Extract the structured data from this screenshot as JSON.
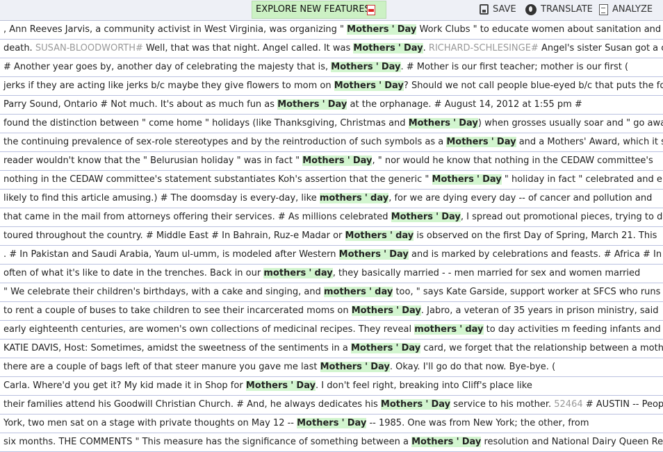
{
  "toolbar": {
    "explore_label": "EXPLORE NEW FEATURES",
    "save_label": "SAVE",
    "translate_label": "TRANSLATE",
    "analyze_label": "ANALYZE"
  },
  "rows": [
    {
      "segments": [
        {
          "t": "text",
          "v": ", Ann Reeves Jarvis, a community activist in West Virginia, was organizing \" "
        },
        {
          "t": "kw",
          "a": "Mothers",
          "b": "'",
          "c": "Day"
        },
        {
          "t": "text",
          "v": " Work Clubs \" to educate women about sanitation and public health"
        }
      ]
    },
    {
      "segments": [
        {
          "t": "text",
          "v": "death. "
        },
        {
          "t": "meta",
          "v": "SUSAN-BLOODWORTH#"
        },
        {
          "t": "text",
          "v": " Well, that was that night. Angel called. It was "
        },
        {
          "t": "kw",
          "a": "Mothers",
          "b": "'",
          "c": "Day"
        },
        {
          "t": "text",
          "v": ". "
        },
        {
          "t": "meta",
          "v": "RICHARD-SCHLESINGE#"
        },
        {
          "t": "text",
          "v": " Angel's sister Susan got a call that even"
        }
      ]
    },
    {
      "segments": [
        {
          "t": "text",
          "v": "# Another year goes by, another day of celebrating the majesty that is, "
        },
        {
          "t": "kw",
          "a": "Mothers",
          "b": "'",
          "c": "Day"
        },
        {
          "t": "text",
          "v": ". # Mother is our first teacher; mother is our first ("
        }
      ]
    },
    {
      "segments": [
        {
          "t": "text",
          "v": "jerks if they are acting like jerks b/c maybe they give flowers to mom on "
        },
        {
          "t": "kw",
          "a": "Mothers",
          "b": "'",
          "c": "Day"
        },
        {
          "t": "text",
          "v": "? Should we not call people blue-eyed b/c that puts the focus on"
        }
      ]
    },
    {
      "segments": [
        {
          "t": "text",
          "v": "Parry Sound, Ontario # Not much. It's about as much fun as "
        },
        {
          "t": "kw",
          "a": "Mothers",
          "b": "'",
          "c": "Day"
        },
        {
          "t": "text",
          "v": " at the orphanage. # August 14, 2012 at 1:55 pm #"
        }
      ]
    },
    {
      "segments": [
        {
          "t": "text",
          "v": "found the distinction between \" come home \" holidays (like Thanksgiving, Christmas and "
        },
        {
          "t": "kw",
          "a": "Mothers",
          "b": "'",
          "c": "Day"
        },
        {
          "t": "text",
          "v": ") when grosses usually soar and \" go away \" holidays"
        }
      ]
    },
    {
      "segments": [
        {
          "t": "text",
          "v": "the continuing prevalence of sex-role stereotypes and by the reintroduction of such symbols as a "
        },
        {
          "t": "kw",
          "a": "Mothers",
          "b": "'",
          "c": "Day"
        },
        {
          "t": "text",
          "v": " and a Mothers' Award, which it sees as enc"
        }
      ]
    },
    {
      "segments": [
        {
          "t": "text",
          "v": "reader wouldn't know that the \" Belurusian holiday \" was in fact \" "
        },
        {
          "t": "kw",
          "a": "Mothers",
          "b": "'",
          "c": "Day"
        },
        {
          "t": "text",
          "v": ", \" nor would he know that nothing in the CEDAW committee's"
        }
      ]
    },
    {
      "segments": [
        {
          "t": "text",
          "v": "nothing in the CEDAW committee's statement substantiates Koh's assertion that the generic \" "
        },
        {
          "t": "kw",
          "a": "Mothers",
          "b": "'",
          "c": "Day"
        },
        {
          "t": "text",
          "v": " \" holiday in fact \" celebrated and encouraged"
        }
      ]
    },
    {
      "segments": [
        {
          "t": "text",
          "v": "likely to find this article amusing.) # The doomsday is every-day, like "
        },
        {
          "t": "kw",
          "a": "mothers",
          "b": "'",
          "c": "day"
        },
        {
          "t": "text",
          "v": ", for we are dying every day -- of cancer and pollution and"
        }
      ]
    },
    {
      "segments": [
        {
          "t": "text",
          "v": "that came in the mail from attorneys offering their services. # As millions celebrated "
        },
        {
          "t": "kw",
          "a": "Mothers",
          "b": "'",
          "c": "Day"
        },
        {
          "t": "text",
          "v": ", I spread out promotional pieces, trying to distinguish in"
        }
      ]
    },
    {
      "segments": [
        {
          "t": "text",
          "v": "toured throughout the country. # Middle East # In Bahrain, Ruz-e Madar or "
        },
        {
          "t": "kw",
          "a": "Mothers",
          "b": "'",
          "c": "day"
        },
        {
          "t": "text",
          "v": " is observed on the first Day of Spring, March 21. This"
        }
      ]
    },
    {
      "segments": [
        {
          "t": "text",
          "v": ". # In Pakistan and Saudi Arabia, Yaum ul-umm, is modeled after Western "
        },
        {
          "t": "kw",
          "a": "Mothers",
          "b": "'",
          "c": "Day"
        },
        {
          "t": "text",
          "v": " and is marked by celebrations and feasts. # Africa # In Ethiopia"
        }
      ]
    },
    {
      "segments": [
        {
          "t": "text",
          "v": "often of what it's like to date in the trenches. Back in our "
        },
        {
          "t": "kw",
          "a": "mothers",
          "b": "'",
          "c": "day"
        },
        {
          "t": "text",
          "v": ", they basically married - - men married for sex and women married"
        }
      ]
    },
    {
      "segments": [
        {
          "t": "text",
          "v": "\" We celebrate their children's birthdays, with a cake and singing, and "
        },
        {
          "t": "kw",
          "a": "mothers",
          "b": "'",
          "c": "day"
        },
        {
          "t": "text",
          "v": " too, \" says Kate Garside, support worker at SFCS who runs"
        }
      ]
    },
    {
      "segments": [
        {
          "t": "text",
          "v": "to rent a couple of buses to take children to see their incarcerated moms on "
        },
        {
          "t": "kw",
          "a": "Mothers",
          "b": "'",
          "c": "Day"
        },
        {
          "t": "text",
          "v": ". Jabro, a veteran of 35 years in prison ministry, said"
        }
      ]
    },
    {
      "segments": [
        {
          "t": "text",
          "v": "early eighteenth centuries, are women's own collections of medicinal recipes. They reveal "
        },
        {
          "t": "kw",
          "a": "mothers",
          "b": "'",
          "c": "day"
        },
        {
          "t": "text",
          "v": " to day activities m feeding infants and caring for ch"
        }
      ]
    },
    {
      "segments": [
        {
          "t": "text",
          "v": "KATIE DAVIS, Host: Sometimes, amidst the sweetness of the sentiments in a "
        },
        {
          "t": "kw",
          "a": "Mothers",
          "b": "'",
          "c": "Day"
        },
        {
          "t": "text",
          "v": " card, we forget that the relationship between a mother and child"
        }
      ]
    },
    {
      "segments": [
        {
          "t": "text",
          "v": "there are a couple of bags left of that steer manure you gave me last "
        },
        {
          "t": "kw",
          "a": "Mothers",
          "b": "'",
          "c": "Day"
        },
        {
          "t": "text",
          "v": ". Okay. I'll go do that now. Bye-bye. ("
        }
      ]
    },
    {
      "segments": [
        {
          "t": "text",
          "v": "Carla. Where'd you get it? My kid made it in Shop for "
        },
        {
          "t": "kw",
          "a": "Mothers",
          "b": "'",
          "c": "Day"
        },
        {
          "t": "text",
          "v": ". I don't feel right, breaking into Cliff's place like"
        }
      ]
    },
    {
      "segments": [
        {
          "t": "text",
          "v": "their families attend his Goodwill Christian Church. # And, he always dedicates his "
        },
        {
          "t": "kw",
          "a": "Mothers",
          "b": "'",
          "c": "Day"
        },
        {
          "t": "text",
          "v": " service to his mother. "
        },
        {
          "t": "meta",
          "v": "52464"
        },
        {
          "t": "text",
          "v": " # AUSTIN -- People who have"
        }
      ]
    },
    {
      "segments": [
        {
          "t": "text",
          "v": "York, two men sat on a stage with private thoughts on May 12 -- "
        },
        {
          "t": "kw",
          "a": "Mothers",
          "b": "'",
          "c": "Day"
        },
        {
          "t": "text",
          "v": " -- 1985. One was from New York; the other, from"
        }
      ]
    },
    {
      "segments": [
        {
          "t": "text",
          "v": "six months. THE COMMENTS \" This measure has the significance of something between a "
        },
        {
          "t": "kw",
          "a": "Mothers",
          "b": "'",
          "c": "Day"
        },
        {
          "t": "text",
          "v": " resolution and National Dairy Queen Recognition M"
        }
      ]
    }
  ]
}
